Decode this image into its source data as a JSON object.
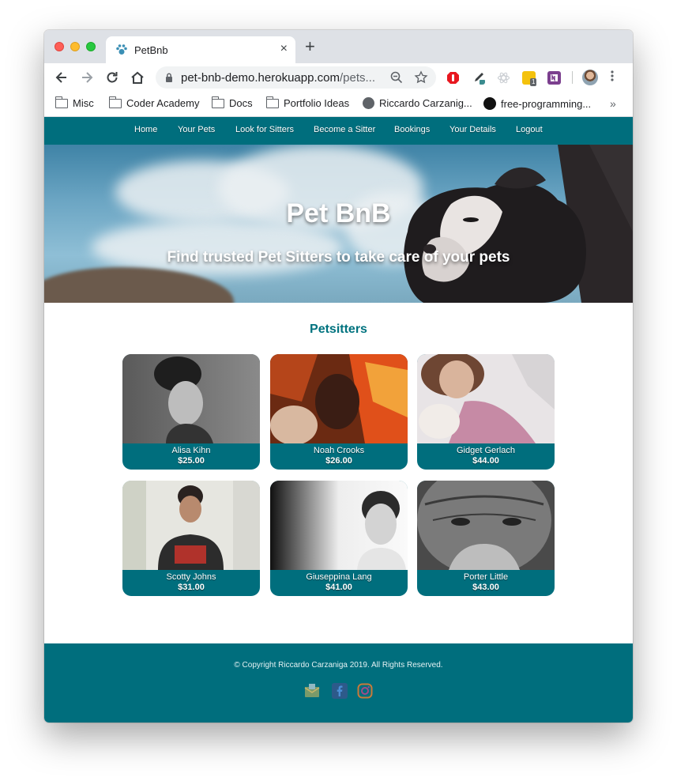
{
  "browser": {
    "tab_title": "PetBnb",
    "tab_close": "×",
    "new_tab": "+",
    "url_host": "pet-bnb-demo.herokuapp.com",
    "url_path": "/pets...",
    "bookmarks": [
      "Misc",
      "Coder Academy",
      "Docs",
      "Portfolio Ideas",
      "Riccardo Carzanig...",
      "free-programming..."
    ],
    "bookmarks_more": "»",
    "extension_badge": "1"
  },
  "nav": {
    "items": [
      "Home",
      "Your Pets",
      "Look for Sitters",
      "Become a Sitter",
      "Bookings",
      "Your Details",
      "Logout"
    ]
  },
  "hero": {
    "title": "Pet BnB",
    "subtitle": "Find trusted Pet Sitters to take care of your pets"
  },
  "section_title": "Petsitters",
  "sitters": [
    {
      "name": "Alisa Kihn",
      "price": "$25.00"
    },
    {
      "name": "Noah Crooks",
      "price": "$26.00"
    },
    {
      "name": "Gidget Gerlach",
      "price": "$44.00"
    },
    {
      "name": "Scotty Johns",
      "price": "$31.00"
    },
    {
      "name": "Giuseppina Lang",
      "price": "$41.00"
    },
    {
      "name": "Porter Little",
      "price": "$43.00"
    }
  ],
  "footer": {
    "copyright": "© Copyright Riccardo Carzaniga 2019. All Rights Reserved.",
    "social_icons": [
      "email-icon",
      "facebook-icon",
      "instagram-icon"
    ]
  },
  "colors": {
    "brand_teal": "#006e7d",
    "heading_teal": "#00737f"
  }
}
